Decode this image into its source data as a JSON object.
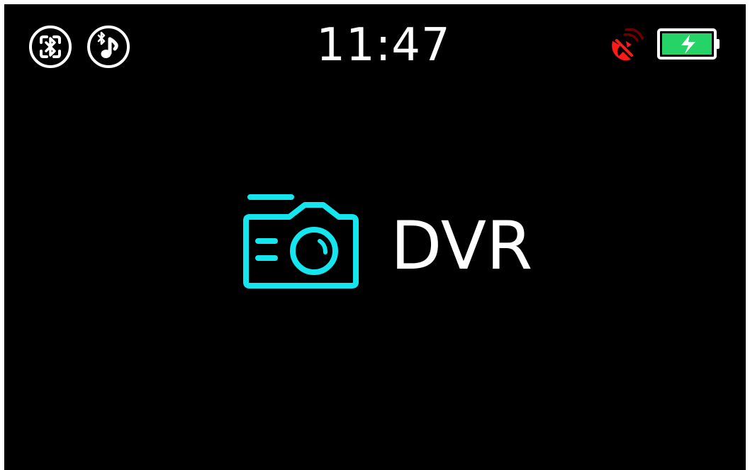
{
  "status_bar": {
    "left_icons": [
      {
        "name": "bluetooth-device-icon",
        "color": "#ffffff"
      },
      {
        "name": "bluetooth-music-icon",
        "color": "#ffffff"
      }
    ],
    "time": "11:47",
    "signal": {
      "name": "satellite-signal-icon",
      "color": "#ff1a1a",
      "wave_color": "#6b0000"
    },
    "battery": {
      "name": "battery-charging-icon",
      "fill_color": "#25d366",
      "frame_color": "#ffffff",
      "charging": true
    }
  },
  "main": {
    "mode": {
      "label": "DVR",
      "icon": "camera-icon",
      "icon_color": "#14e6f0"
    }
  }
}
